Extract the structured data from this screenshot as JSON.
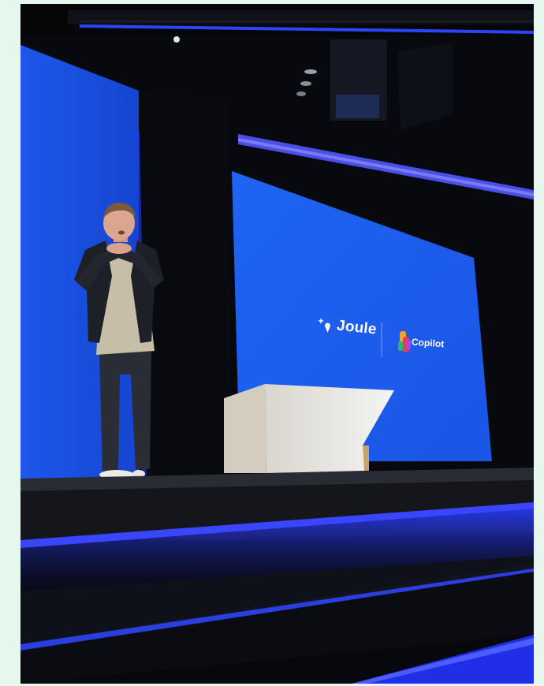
{
  "scene": {
    "description_hidden": "",
    "background_color": "#e6f7ee",
    "stage_accent_color": "#1f4df0",
    "screen_color": "#1f63f0"
  },
  "screen": {
    "brand_left": "Joule",
    "brand_right": "Copilot",
    "icon_left": "joule-sparkle-icon",
    "icon_right": "copilot-logo-icon"
  }
}
